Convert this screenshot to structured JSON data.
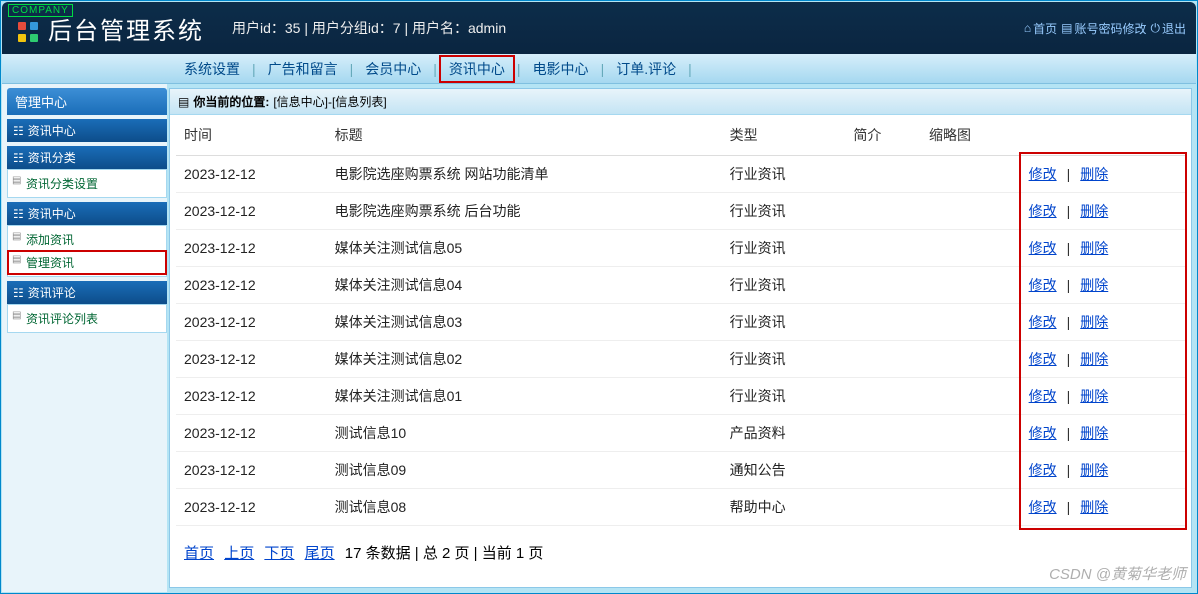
{
  "header": {
    "company_tag": "COMPANY",
    "title": "后台管理系统",
    "user_info": "用户id：35 | 用户分组id：7 | 用户名：admin",
    "links": {
      "home": "首页",
      "password": "账号密码修改",
      "logout": "退出"
    }
  },
  "topnav": {
    "items": [
      "系统设置",
      "广告和留言",
      "会员中心",
      "资讯中心",
      "电影中心",
      "订单.评论"
    ],
    "active_index": 3
  },
  "sidebar": {
    "main_title": "管理中心",
    "sections": [
      {
        "head": "资讯中心",
        "items": []
      },
      {
        "head": "资讯分类",
        "items": [
          "资讯分类设置"
        ]
      },
      {
        "head": "资讯中心",
        "items": [
          "添加资讯",
          "管理资讯"
        ],
        "highlight_index": 1
      },
      {
        "head": "资讯评论",
        "items": [
          "资讯评论列表"
        ]
      }
    ]
  },
  "breadcrumb": {
    "label": "你当前的位置:",
    "path": "[信息中心]-[信息列表]"
  },
  "table": {
    "headers": [
      "时间",
      "标题",
      "类型",
      "简介",
      "缩略图",
      ""
    ],
    "rows": [
      {
        "time": "2023-12-12",
        "title": "电影院选座购票系统 网站功能清单",
        "type": "行业资讯",
        "intro": "",
        "thumb": ""
      },
      {
        "time": "2023-12-12",
        "title": "电影院选座购票系统 后台功能",
        "type": "行业资讯",
        "intro": "",
        "thumb": ""
      },
      {
        "time": "2023-12-12",
        "title": "媒体关注测试信息05",
        "type": "行业资讯",
        "intro": "",
        "thumb": ""
      },
      {
        "time": "2023-12-12",
        "title": "媒体关注测试信息04",
        "type": "行业资讯",
        "intro": "",
        "thumb": ""
      },
      {
        "time": "2023-12-12",
        "title": "媒体关注测试信息03",
        "type": "行业资讯",
        "intro": "",
        "thumb": ""
      },
      {
        "time": "2023-12-12",
        "title": "媒体关注测试信息02",
        "type": "行业资讯",
        "intro": "",
        "thumb": ""
      },
      {
        "time": "2023-12-12",
        "title": "媒体关注测试信息01",
        "type": "行业资讯",
        "intro": "",
        "thumb": ""
      },
      {
        "time": "2023-12-12",
        "title": "测试信息10",
        "type": "产品资料",
        "intro": "",
        "thumb": ""
      },
      {
        "time": "2023-12-12",
        "title": "测试信息09",
        "type": "通知公告",
        "intro": "",
        "thumb": ""
      },
      {
        "time": "2023-12-12",
        "title": "测试信息08",
        "type": "帮助中心",
        "intro": "",
        "thumb": ""
      }
    ],
    "action_edit": "修改",
    "action_delete": "删除"
  },
  "pager": {
    "first": "首页",
    "prev": "上页",
    "next": "下页",
    "last": "尾页",
    "info": "17 条数据 | 总 2 页 | 当前 1 页"
  },
  "watermark": "CSDN @黄菊华老师"
}
